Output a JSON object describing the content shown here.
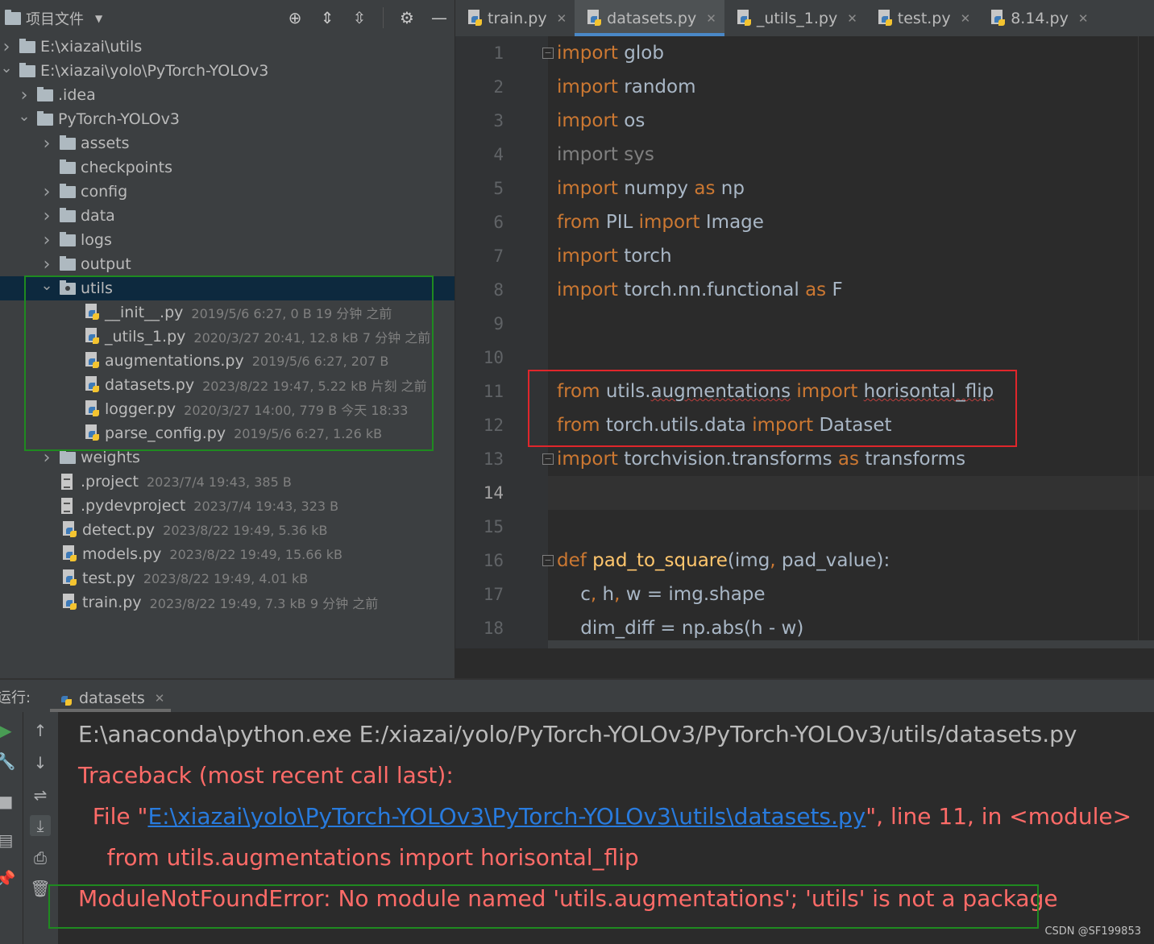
{
  "project_panel": {
    "title": "项目文件",
    "header_icons": [
      "locate-icon",
      "expand-all-icon",
      "collapse-all-icon",
      "gear-icon",
      "hide-icon"
    ]
  },
  "tree": [
    {
      "label": "E:\\xiazai\\utils",
      "meta": "",
      "type": "folder",
      "arrow": "right"
    },
    {
      "label": "E:\\xiazai\\yolo\\PyTorch-YOLOv3",
      "meta": "",
      "type": "folder",
      "arrow": "down"
    },
    {
      "label": ".idea",
      "meta": "",
      "type": "folder",
      "arrow": "right"
    },
    {
      "label": "PyTorch-YOLOv3",
      "meta": "",
      "type": "folder",
      "arrow": "down"
    },
    {
      "label": "assets",
      "meta": "",
      "type": "folder",
      "arrow": "right"
    },
    {
      "label": "checkpoints",
      "meta": "",
      "type": "folder",
      "arrow": ""
    },
    {
      "label": "config",
      "meta": "",
      "type": "folder",
      "arrow": "right"
    },
    {
      "label": "data",
      "meta": "",
      "type": "folder",
      "arrow": "right"
    },
    {
      "label": "logs",
      "meta": "",
      "type": "folder",
      "arrow": "right"
    },
    {
      "label": "output",
      "meta": "",
      "type": "folder",
      "arrow": "right"
    },
    {
      "label": "utils",
      "meta": "",
      "type": "package",
      "arrow": "down",
      "selected": true
    },
    {
      "label": "__init__.py",
      "meta": "2019/5/6 6:27, 0 B 19 分钟 之前",
      "type": "py"
    },
    {
      "label": "_utils_1.py",
      "meta": "2020/3/27 20:41, 12.8 kB 7 分钟 之前",
      "type": "py"
    },
    {
      "label": "augmentations.py",
      "meta": "2019/5/6 6:27, 207 B",
      "type": "py"
    },
    {
      "label": "datasets.py",
      "meta": "2023/8/22 19:47, 5.22 kB 片刻 之前",
      "type": "py"
    },
    {
      "label": "logger.py",
      "meta": "2020/3/27 14:00, 779 B 今天 18:33",
      "type": "py"
    },
    {
      "label": "parse_config.py",
      "meta": "2019/5/6 6:27, 1.26 kB",
      "type": "py"
    },
    {
      "label": "weights",
      "meta": "",
      "type": "folder",
      "arrow": "right"
    },
    {
      "label": ".project",
      "meta": "2023/7/4 19:43, 385 B",
      "type": "txt"
    },
    {
      "label": ".pydevproject",
      "meta": "2023/7/4 19:43, 323 B",
      "type": "txt"
    },
    {
      "label": "detect.py",
      "meta": "2023/8/22 19:49, 5.36 kB",
      "type": "py"
    },
    {
      "label": "models.py",
      "meta": "2023/8/22 19:49, 15.66 kB",
      "type": "py"
    },
    {
      "label": "test.py",
      "meta": "2023/8/22 19:49, 4.01 kB",
      "type": "py"
    },
    {
      "label": "train.py",
      "meta": "2023/8/22 19:49, 7.3 kB 9 分钟 之前",
      "type": "py"
    }
  ],
  "tabs": [
    {
      "label": "train.py",
      "active": false
    },
    {
      "label": "datasets.py",
      "active": true
    },
    {
      "label": "_utils_1.py",
      "active": false
    },
    {
      "label": "test.py",
      "active": false
    },
    {
      "label": "8.14.py",
      "active": false
    }
  ],
  "line_numbers": [
    "1",
    "2",
    "3",
    "4",
    "5",
    "6",
    "7",
    "8",
    "9",
    "10",
    "11",
    "12",
    "13",
    "14",
    "15",
    "16",
    "17",
    "18"
  ],
  "current_line": "14",
  "code_lines": [
    [
      {
        "t": "import",
        "c": "kw"
      },
      {
        "t": " glob",
        "c": ""
      }
    ],
    [
      {
        "t": "import",
        "c": "kw"
      },
      {
        "t": " random",
        "c": ""
      }
    ],
    [
      {
        "t": "import",
        "c": "kw"
      },
      {
        "t": " os",
        "c": ""
      }
    ],
    [
      {
        "t": "import sys",
        "c": "dim"
      }
    ],
    [
      {
        "t": "import",
        "c": "kw"
      },
      {
        "t": " numpy ",
        "c": ""
      },
      {
        "t": "as",
        "c": "kw"
      },
      {
        "t": " np",
        "c": ""
      }
    ],
    [
      {
        "t": "from",
        "c": "kw"
      },
      {
        "t": " PIL ",
        "c": ""
      },
      {
        "t": "import",
        "c": "kw"
      },
      {
        "t": " Image",
        "c": ""
      }
    ],
    [
      {
        "t": "import",
        "c": "kw"
      },
      {
        "t": " torch",
        "c": ""
      }
    ],
    [
      {
        "t": "import",
        "c": "kw"
      },
      {
        "t": " torch.nn.functional ",
        "c": ""
      },
      {
        "t": "as",
        "c": "kw"
      },
      {
        "t": " F",
        "c": ""
      }
    ],
    [],
    [],
    [
      {
        "t": "from",
        "c": "kw"
      },
      {
        "t": " utils.",
        "c": ""
      },
      {
        "t": "augmentations",
        "c": "wavy"
      },
      {
        "t": " ",
        "c": ""
      },
      {
        "t": "import",
        "c": "kw"
      },
      {
        "t": " ",
        "c": ""
      },
      {
        "t": "horisontal_flip",
        "c": "wavy"
      }
    ],
    [
      {
        "t": "from",
        "c": "kw"
      },
      {
        "t": " torch.utils.data ",
        "c": ""
      },
      {
        "t": "import",
        "c": "kw"
      },
      {
        "t": " Dataset",
        "c": ""
      }
    ],
    [
      {
        "t": "import",
        "c": "kw"
      },
      {
        "t": " torchvision.transforms ",
        "c": ""
      },
      {
        "t": "as",
        "c": "kw"
      },
      {
        "t": " transforms",
        "c": ""
      }
    ],
    [],
    [],
    [
      {
        "t": "def",
        "c": "kw"
      },
      {
        "t": " ",
        "c": ""
      },
      {
        "t": "pad_to_square",
        "c": "fn"
      },
      {
        "t": "(img",
        "c": ""
      },
      {
        "t": ",",
        "c": "kw"
      },
      {
        "t": " pad_value):",
        "c": ""
      }
    ],
    [
      {
        "t": "    c",
        "c": ""
      },
      {
        "t": ",",
        "c": "kw"
      },
      {
        "t": " h",
        "c": ""
      },
      {
        "t": ",",
        "c": "kw"
      },
      {
        "t": " w = img.shape",
        "c": ""
      }
    ],
    [
      {
        "t": "    dim_diff = np.abs(h - w)",
        "c": ""
      }
    ]
  ],
  "run": {
    "label": "运行:",
    "tab_label": "datasets",
    "command": "E:\\anaconda\\python.exe E:/xiazai/yolo/PyTorch-YOLOv3/PyTorch-YOLOv3/utils/datasets.py",
    "traceback": "Traceback (most recent call last):",
    "file_prefix": "  File \"",
    "file_link": "E:\\xiazai\\yolo\\PyTorch-YOLOv3\\PyTorch-YOLOv3\\utils\\datasets.py",
    "file_suffix": "\", line 11, in <module>",
    "source_line": "    from utils.augmentations import horisontal_flip",
    "error": "ModuleNotFoundError: No module named 'utils.augmentations'; 'utils' is not a package"
  },
  "watermark": "CSDN @SF199853",
  "colors": {
    "keyword": "#cc7832",
    "error": "#ff6b68",
    "link": "#287bde",
    "highlight_red": "#e0262b",
    "highlight_green": "#1f8a20"
  }
}
